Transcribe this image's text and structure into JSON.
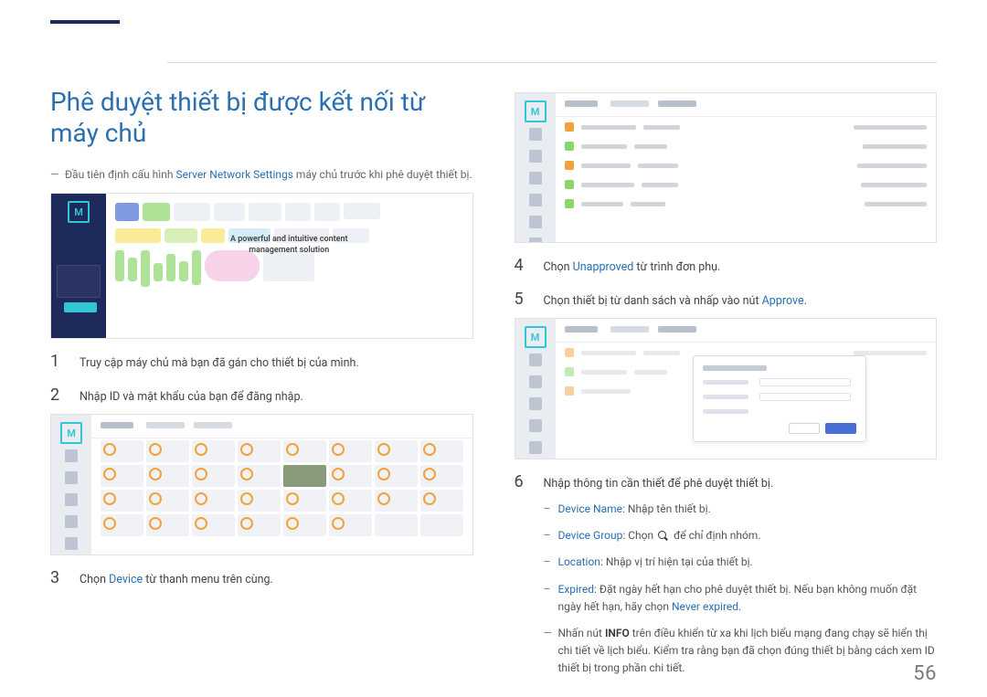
{
  "page_number": "56",
  "heading": "Phê duyệt thiết bị được kết nối từ máy chủ",
  "intro_note_pre": "Đầu tiên định cấu hình ",
  "intro_note_link": "Server Network Settings",
  "intro_note_post": " máy chủ trước khi phê duyệt thiết bị.",
  "ss1_tagline": "A powerful and intuitive content\nmanagement solution",
  "steps_left": {
    "1": "Truy cập máy chủ mà bạn đã gán cho thiết bị của mình.",
    "2": "Nhập ID và mật khẩu của bạn để đăng nhập.",
    "3_pre": "Chọn ",
    "3_link": "Device",
    "3_post": " từ thanh menu trên cùng."
  },
  "steps_right": {
    "4_pre": "Chọn ",
    "4_link": "Unapproved",
    "4_post": " từ trình đơn phụ.",
    "5_pre": "Chọn thiết bị từ danh sách và nhấp vào nút ",
    "5_link": "Approve",
    "5_post": ".",
    "6": "Nhập thông tin cần thiết để phê duyệt thiết bị."
  },
  "sub": {
    "device_name_label": "Device Name",
    "device_name_text": ": Nhập tên thiết bị.",
    "device_group_label": "Device Group",
    "device_group_text_pre": ": Chọn ",
    "device_group_text_post": " để chỉ định nhóm.",
    "location_label": "Location",
    "location_text": ": Nhập vị trí hiện tại của thiết bị.",
    "expired_label": "Expired",
    "expired_text_pre": ": Đặt ngày hết hạn cho phê duyệt thiết bị. Nếu bạn không muốn đặt ngày hết hạn, hãy chọn ",
    "expired_link": "Never expired",
    "expired_text_post": ".",
    "info_pre": "Nhấn nút ",
    "info_bold": "INFO",
    "info_post": " trên điều khiển từ xa khi lịch biểu mạng đang chạy sẽ hiển thị chi tiết về lịch biểu. Kiểm tra rằng bạn đã chọn đúng thiết bị bằng cách xem ID thiết bị trong phần chi tiết."
  }
}
